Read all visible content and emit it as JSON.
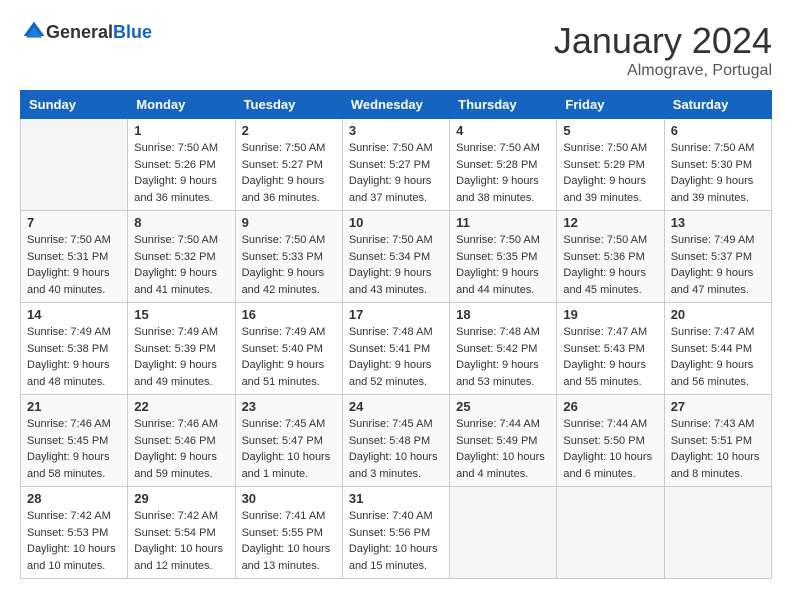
{
  "header": {
    "logo_general": "General",
    "logo_blue": "Blue",
    "month_title": "January 2024",
    "location": "Almograve, Portugal"
  },
  "days_of_week": [
    "Sunday",
    "Monday",
    "Tuesday",
    "Wednesday",
    "Thursday",
    "Friday",
    "Saturday"
  ],
  "weeks": [
    [
      {
        "day": "",
        "sunrise": "",
        "sunset": "",
        "daylight": ""
      },
      {
        "day": "1",
        "sunrise": "Sunrise: 7:50 AM",
        "sunset": "Sunset: 5:26 PM",
        "daylight": "Daylight: 9 hours and 36 minutes."
      },
      {
        "day": "2",
        "sunrise": "Sunrise: 7:50 AM",
        "sunset": "Sunset: 5:27 PM",
        "daylight": "Daylight: 9 hours and 36 minutes."
      },
      {
        "day": "3",
        "sunrise": "Sunrise: 7:50 AM",
        "sunset": "Sunset: 5:27 PM",
        "daylight": "Daylight: 9 hours and 37 minutes."
      },
      {
        "day": "4",
        "sunrise": "Sunrise: 7:50 AM",
        "sunset": "Sunset: 5:28 PM",
        "daylight": "Daylight: 9 hours and 38 minutes."
      },
      {
        "day": "5",
        "sunrise": "Sunrise: 7:50 AM",
        "sunset": "Sunset: 5:29 PM",
        "daylight": "Daylight: 9 hours and 39 minutes."
      },
      {
        "day": "6",
        "sunrise": "Sunrise: 7:50 AM",
        "sunset": "Sunset: 5:30 PM",
        "daylight": "Daylight: 9 hours and 39 minutes."
      }
    ],
    [
      {
        "day": "7",
        "sunrise": "Sunrise: 7:50 AM",
        "sunset": "Sunset: 5:31 PM",
        "daylight": "Daylight: 9 hours and 40 minutes."
      },
      {
        "day": "8",
        "sunrise": "Sunrise: 7:50 AM",
        "sunset": "Sunset: 5:32 PM",
        "daylight": "Daylight: 9 hours and 41 minutes."
      },
      {
        "day": "9",
        "sunrise": "Sunrise: 7:50 AM",
        "sunset": "Sunset: 5:33 PM",
        "daylight": "Daylight: 9 hours and 42 minutes."
      },
      {
        "day": "10",
        "sunrise": "Sunrise: 7:50 AM",
        "sunset": "Sunset: 5:34 PM",
        "daylight": "Daylight: 9 hours and 43 minutes."
      },
      {
        "day": "11",
        "sunrise": "Sunrise: 7:50 AM",
        "sunset": "Sunset: 5:35 PM",
        "daylight": "Daylight: 9 hours and 44 minutes."
      },
      {
        "day": "12",
        "sunrise": "Sunrise: 7:50 AM",
        "sunset": "Sunset: 5:36 PM",
        "daylight": "Daylight: 9 hours and 45 minutes."
      },
      {
        "day": "13",
        "sunrise": "Sunrise: 7:49 AM",
        "sunset": "Sunset: 5:37 PM",
        "daylight": "Daylight: 9 hours and 47 minutes."
      }
    ],
    [
      {
        "day": "14",
        "sunrise": "Sunrise: 7:49 AM",
        "sunset": "Sunset: 5:38 PM",
        "daylight": "Daylight: 9 hours and 48 minutes."
      },
      {
        "day": "15",
        "sunrise": "Sunrise: 7:49 AM",
        "sunset": "Sunset: 5:39 PM",
        "daylight": "Daylight: 9 hours and 49 minutes."
      },
      {
        "day": "16",
        "sunrise": "Sunrise: 7:49 AM",
        "sunset": "Sunset: 5:40 PM",
        "daylight": "Daylight: 9 hours and 51 minutes."
      },
      {
        "day": "17",
        "sunrise": "Sunrise: 7:48 AM",
        "sunset": "Sunset: 5:41 PM",
        "daylight": "Daylight: 9 hours and 52 minutes."
      },
      {
        "day": "18",
        "sunrise": "Sunrise: 7:48 AM",
        "sunset": "Sunset: 5:42 PM",
        "daylight": "Daylight: 9 hours and 53 minutes."
      },
      {
        "day": "19",
        "sunrise": "Sunrise: 7:47 AM",
        "sunset": "Sunset: 5:43 PM",
        "daylight": "Daylight: 9 hours and 55 minutes."
      },
      {
        "day": "20",
        "sunrise": "Sunrise: 7:47 AM",
        "sunset": "Sunset: 5:44 PM",
        "daylight": "Daylight: 9 hours and 56 minutes."
      }
    ],
    [
      {
        "day": "21",
        "sunrise": "Sunrise: 7:46 AM",
        "sunset": "Sunset: 5:45 PM",
        "daylight": "Daylight: 9 hours and 58 minutes."
      },
      {
        "day": "22",
        "sunrise": "Sunrise: 7:46 AM",
        "sunset": "Sunset: 5:46 PM",
        "daylight": "Daylight: 9 hours and 59 minutes."
      },
      {
        "day": "23",
        "sunrise": "Sunrise: 7:45 AM",
        "sunset": "Sunset: 5:47 PM",
        "daylight": "Daylight: 10 hours and 1 minute."
      },
      {
        "day": "24",
        "sunrise": "Sunrise: 7:45 AM",
        "sunset": "Sunset: 5:48 PM",
        "daylight": "Daylight: 10 hours and 3 minutes."
      },
      {
        "day": "25",
        "sunrise": "Sunrise: 7:44 AM",
        "sunset": "Sunset: 5:49 PM",
        "daylight": "Daylight: 10 hours and 4 minutes."
      },
      {
        "day": "26",
        "sunrise": "Sunrise: 7:44 AM",
        "sunset": "Sunset: 5:50 PM",
        "daylight": "Daylight: 10 hours and 6 minutes."
      },
      {
        "day": "27",
        "sunrise": "Sunrise: 7:43 AM",
        "sunset": "Sunset: 5:51 PM",
        "daylight": "Daylight: 10 hours and 8 minutes."
      }
    ],
    [
      {
        "day": "28",
        "sunrise": "Sunrise: 7:42 AM",
        "sunset": "Sunset: 5:53 PM",
        "daylight": "Daylight: 10 hours and 10 minutes."
      },
      {
        "day": "29",
        "sunrise": "Sunrise: 7:42 AM",
        "sunset": "Sunset: 5:54 PM",
        "daylight": "Daylight: 10 hours and 12 minutes."
      },
      {
        "day": "30",
        "sunrise": "Sunrise: 7:41 AM",
        "sunset": "Sunset: 5:55 PM",
        "daylight": "Daylight: 10 hours and 13 minutes."
      },
      {
        "day": "31",
        "sunrise": "Sunrise: 7:40 AM",
        "sunset": "Sunset: 5:56 PM",
        "daylight": "Daylight: 10 hours and 15 minutes."
      },
      {
        "day": "",
        "sunrise": "",
        "sunset": "",
        "daylight": ""
      },
      {
        "day": "",
        "sunrise": "",
        "sunset": "",
        "daylight": ""
      },
      {
        "day": "",
        "sunrise": "",
        "sunset": "",
        "daylight": ""
      }
    ]
  ]
}
